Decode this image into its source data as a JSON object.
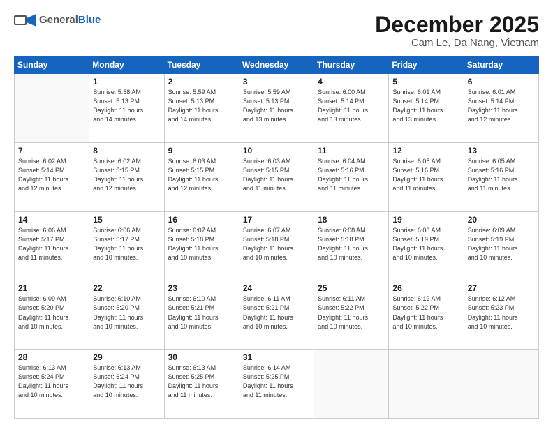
{
  "header": {
    "logo_general": "General",
    "logo_blue": "Blue",
    "month_title": "December 2025",
    "location": "Cam Le, Da Nang, Vietnam"
  },
  "weekdays": [
    "Sunday",
    "Monday",
    "Tuesday",
    "Wednesday",
    "Thursday",
    "Friday",
    "Saturday"
  ],
  "weeks": [
    [
      {
        "day": "",
        "info": ""
      },
      {
        "day": "1",
        "info": "Sunrise: 5:58 AM\nSunset: 5:13 PM\nDaylight: 11 hours\nand 14 minutes."
      },
      {
        "day": "2",
        "info": "Sunrise: 5:59 AM\nSunset: 5:13 PM\nDaylight: 11 hours\nand 14 minutes."
      },
      {
        "day": "3",
        "info": "Sunrise: 5:59 AM\nSunset: 5:13 PM\nDaylight: 11 hours\nand 13 minutes."
      },
      {
        "day": "4",
        "info": "Sunrise: 6:00 AM\nSunset: 5:14 PM\nDaylight: 11 hours\nand 13 minutes."
      },
      {
        "day": "5",
        "info": "Sunrise: 6:01 AM\nSunset: 5:14 PM\nDaylight: 11 hours\nand 13 minutes."
      },
      {
        "day": "6",
        "info": "Sunrise: 6:01 AM\nSunset: 5:14 PM\nDaylight: 11 hours\nand 12 minutes."
      }
    ],
    [
      {
        "day": "7",
        "info": "Sunrise: 6:02 AM\nSunset: 5:14 PM\nDaylight: 11 hours\nand 12 minutes."
      },
      {
        "day": "8",
        "info": "Sunrise: 6:02 AM\nSunset: 5:15 PM\nDaylight: 11 hours\nand 12 minutes."
      },
      {
        "day": "9",
        "info": "Sunrise: 6:03 AM\nSunset: 5:15 PM\nDaylight: 11 hours\nand 12 minutes."
      },
      {
        "day": "10",
        "info": "Sunrise: 6:03 AM\nSunset: 5:15 PM\nDaylight: 11 hours\nand 11 minutes."
      },
      {
        "day": "11",
        "info": "Sunrise: 6:04 AM\nSunset: 5:16 PM\nDaylight: 11 hours\nand 11 minutes."
      },
      {
        "day": "12",
        "info": "Sunrise: 6:05 AM\nSunset: 5:16 PM\nDaylight: 11 hours\nand 11 minutes."
      },
      {
        "day": "13",
        "info": "Sunrise: 6:05 AM\nSunset: 5:16 PM\nDaylight: 11 hours\nand 11 minutes."
      }
    ],
    [
      {
        "day": "14",
        "info": "Sunrise: 6:06 AM\nSunset: 5:17 PM\nDaylight: 11 hours\nand 11 minutes."
      },
      {
        "day": "15",
        "info": "Sunrise: 6:06 AM\nSunset: 5:17 PM\nDaylight: 11 hours\nand 10 minutes."
      },
      {
        "day": "16",
        "info": "Sunrise: 6:07 AM\nSunset: 5:18 PM\nDaylight: 11 hours\nand 10 minutes."
      },
      {
        "day": "17",
        "info": "Sunrise: 6:07 AM\nSunset: 5:18 PM\nDaylight: 11 hours\nand 10 minutes."
      },
      {
        "day": "18",
        "info": "Sunrise: 6:08 AM\nSunset: 5:18 PM\nDaylight: 11 hours\nand 10 minutes."
      },
      {
        "day": "19",
        "info": "Sunrise: 6:08 AM\nSunset: 5:19 PM\nDaylight: 11 hours\nand 10 minutes."
      },
      {
        "day": "20",
        "info": "Sunrise: 6:09 AM\nSunset: 5:19 PM\nDaylight: 11 hours\nand 10 minutes."
      }
    ],
    [
      {
        "day": "21",
        "info": "Sunrise: 6:09 AM\nSunset: 5:20 PM\nDaylight: 11 hours\nand 10 minutes."
      },
      {
        "day": "22",
        "info": "Sunrise: 6:10 AM\nSunset: 5:20 PM\nDaylight: 11 hours\nand 10 minutes."
      },
      {
        "day": "23",
        "info": "Sunrise: 6:10 AM\nSunset: 5:21 PM\nDaylight: 11 hours\nand 10 minutes."
      },
      {
        "day": "24",
        "info": "Sunrise: 6:11 AM\nSunset: 5:21 PM\nDaylight: 11 hours\nand 10 minutes."
      },
      {
        "day": "25",
        "info": "Sunrise: 6:11 AM\nSunset: 5:22 PM\nDaylight: 11 hours\nand 10 minutes."
      },
      {
        "day": "26",
        "info": "Sunrise: 6:12 AM\nSunset: 5:22 PM\nDaylight: 11 hours\nand 10 minutes."
      },
      {
        "day": "27",
        "info": "Sunrise: 6:12 AM\nSunset: 5:23 PM\nDaylight: 11 hours\nand 10 minutes."
      }
    ],
    [
      {
        "day": "28",
        "info": "Sunrise: 6:13 AM\nSunset: 5:24 PM\nDaylight: 11 hours\nand 10 minutes."
      },
      {
        "day": "29",
        "info": "Sunrise: 6:13 AM\nSunset: 5:24 PM\nDaylight: 11 hours\nand 10 minutes."
      },
      {
        "day": "30",
        "info": "Sunrise: 6:13 AM\nSunset: 5:25 PM\nDaylight: 11 hours\nand 11 minutes."
      },
      {
        "day": "31",
        "info": "Sunrise: 6:14 AM\nSunset: 5:25 PM\nDaylight: 11 hours\nand 11 minutes."
      },
      {
        "day": "",
        "info": ""
      },
      {
        "day": "",
        "info": ""
      },
      {
        "day": "",
        "info": ""
      }
    ]
  ]
}
